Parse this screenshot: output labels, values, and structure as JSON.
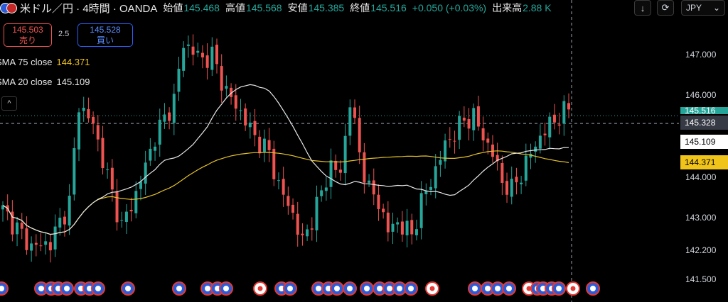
{
  "header": {
    "symbol": "米ドル／円 · 4時間 · OANDA",
    "open_label": "始値",
    "open_value": "145.468",
    "high_label": "高値",
    "high_value": "145.568",
    "low_label": "安値",
    "low_value": "145.385",
    "close_label": "終値",
    "close_value": "145.516",
    "change": "+0.050 (+0.03%)",
    "volume_label": "出来高",
    "volume_value": "2.88 K"
  },
  "toolbar": {
    "down_icon": "↓",
    "settings_icon": "⟳",
    "currency": "JPY",
    "currency_arrow": "⌄"
  },
  "trade": {
    "sell_price": "145.503",
    "sell_label": "売り",
    "spread": "2.5",
    "buy_price": "145.528",
    "buy_label": "買い"
  },
  "indicators": {
    "sma75_label": "SMA 75 close",
    "sma75_value": "144.371",
    "sma20_label": "SMA 20 close",
    "sma20_value": "145.109",
    "collapse_icon": "^"
  },
  "axis": {
    "ticks": [
      "147.000",
      "146.000",
      "144.000",
      "143.000",
      "142.200",
      "141.500"
    ]
  },
  "price_labels": {
    "last": "145.516",
    "crosshair": "145.328",
    "sma20": "145.109",
    "sma75": "144.371"
  },
  "colors": {
    "up": "#26a69a",
    "down": "#ef5350",
    "sma75": "#e5c228",
    "sma20": "#e8e8e8",
    "last": "#26a69a"
  },
  "chart_data": {
    "type": "candlestick",
    "ylim": [
      141.4,
      147.6
    ],
    "candles": [],
    "sma20": [],
    "sma75": []
  }
}
